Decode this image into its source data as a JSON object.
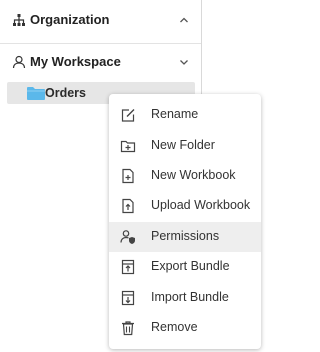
{
  "sidebar": {
    "organization_label": "Organization",
    "workspace_label": "My Workspace",
    "tree_items": [
      {
        "label": "Orders",
        "icon": "folder-icon",
        "color": "#5bb8ea"
      }
    ]
  },
  "context_menu": {
    "highlighted": "Permissions",
    "items": [
      {
        "label": "Rename",
        "icon": "rename-icon"
      },
      {
        "label": "New Folder",
        "icon": "new-folder-icon"
      },
      {
        "label": "New Workbook",
        "icon": "new-workbook-icon"
      },
      {
        "label": "Upload Workbook",
        "icon": "upload-workbook-icon"
      },
      {
        "label": "Permissions",
        "icon": "permissions-icon"
      },
      {
        "label": "Export Bundle",
        "icon": "export-bundle-icon"
      },
      {
        "label": "Import Bundle",
        "icon": "import-bundle-icon"
      },
      {
        "label": "Remove",
        "icon": "trash-icon"
      }
    ]
  }
}
